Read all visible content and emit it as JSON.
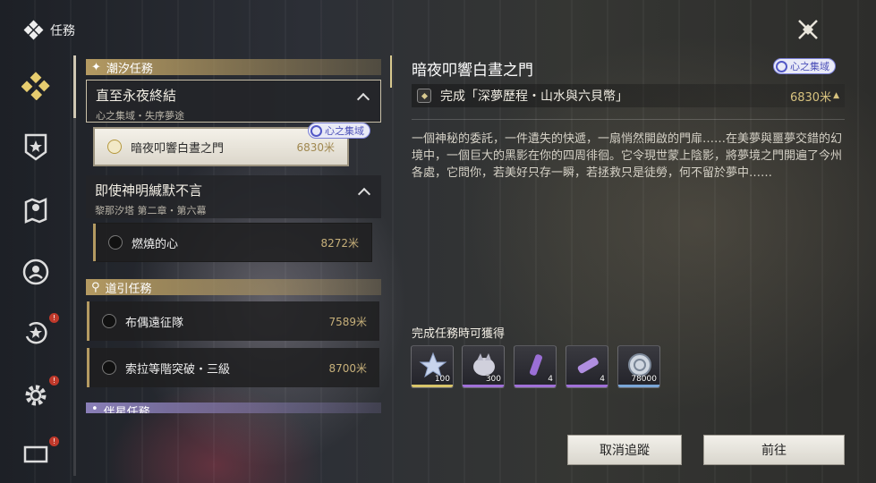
{
  "header": {
    "title": "任務"
  },
  "sidebar": {
    "items": [
      {
        "icon": "diamond-cluster-icon",
        "active": true
      },
      {
        "icon": "shield-star-icon"
      },
      {
        "icon": "map-pin-icon"
      },
      {
        "icon": "person-circle-icon"
      },
      {
        "icon": "star-refresh-icon",
        "alert": "!"
      },
      {
        "icon": "gear-icon",
        "alert": "!"
      },
      {
        "icon": "monitor-icon",
        "alert": "!"
      }
    ]
  },
  "quest_list": {
    "categories": [
      {
        "label": "潮汐任務",
        "icon": "plus-star-icon"
      },
      {
        "label": "道引任務",
        "icon": "location-pin-icon"
      },
      {
        "label": "伴星任務",
        "icon": "dot-icon"
      }
    ],
    "groups": [
      {
        "title": "直至永夜終結",
        "subtitle": "心之集域・失序夢途"
      },
      {
        "title": "即使神明緘默不言",
        "subtitle": "黎那汐塔 第二章・第六幕"
      }
    ],
    "items": [
      {
        "name": "暗夜叩響白晝之門",
        "distance": "6830米",
        "badge": "心之集域"
      },
      {
        "name": "燃燒的心",
        "distance": "8272米"
      },
      {
        "name": "布偶遠征隊",
        "distance": "7589米"
      },
      {
        "name": "索拉等階突破・三級",
        "distance": "8700米"
      }
    ]
  },
  "detail": {
    "title": "暗夜叩響白晝之門",
    "region_badge": "心之集域",
    "objective": "完成「深夢歷程・山水與六貝幣」",
    "objective_distance": "6830米",
    "description": "一個神秘的委託，一件遺失的快遞，一扇悄然開啟的門扉……在美夢與噩夢交錯的幻境中，一個巨大的黑影在你的四周徘徊。它令現世蒙上陰影，將夢境之門開遍了今州各處，它問你，若美好只存一瞬，若拯救只是徒勞，何不留於夢中……",
    "rewards_label": "完成任務時可獲得",
    "rewards": [
      {
        "icon": "crystal-star-icon",
        "count": "100",
        "quality_color": "#d8c46a"
      },
      {
        "icon": "silver-creature-icon",
        "count": "300",
        "quality_color": "#a070d8"
      },
      {
        "icon": "purple-vial-icon",
        "count": "4",
        "quality_color": "#a070d8"
      },
      {
        "icon": "purple-tube-icon",
        "count": "4",
        "quality_color": "#a070d8"
      },
      {
        "icon": "shell-coin-icon",
        "count": "78000",
        "quality_color": "#7aa6d8"
      }
    ]
  },
  "buttons": {
    "untrack": "取消追蹤",
    "go": "前往"
  }
}
